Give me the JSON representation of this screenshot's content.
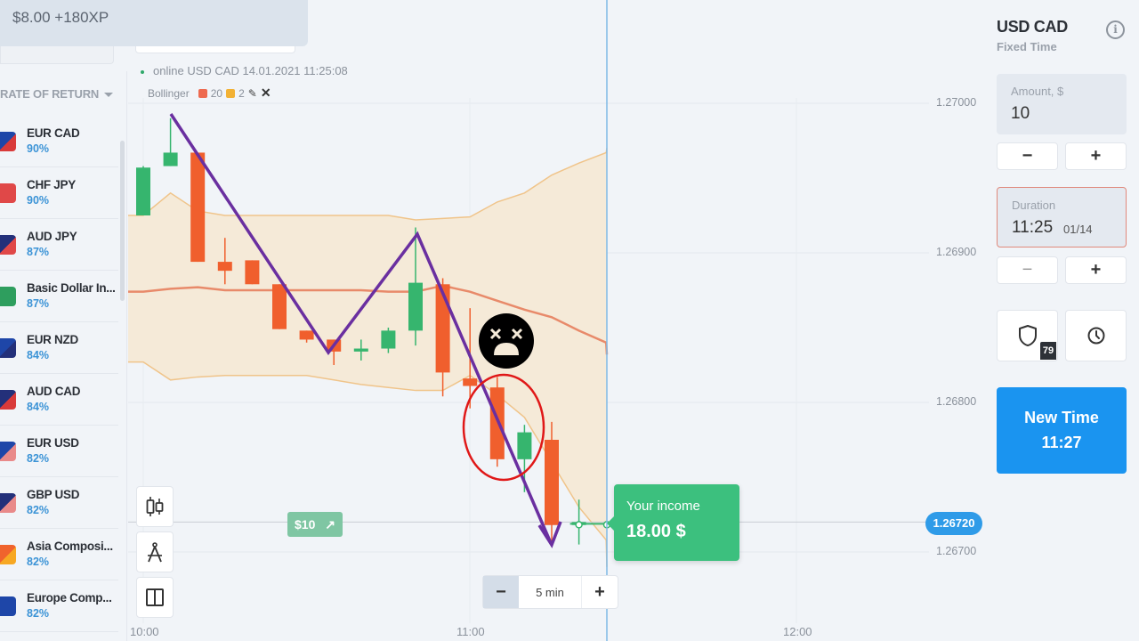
{
  "notification": {
    "text": "$8.00 +180XP"
  },
  "sidebar": {
    "sort_label": "RATE OF RETURN",
    "assets": [
      {
        "name": "EUR CAD",
        "rate": "90%",
        "icon": "eur-cad-flag",
        "color": "#1e46a8",
        "color2": "#d93a3a"
      },
      {
        "name": "CHF JPY",
        "rate": "90%",
        "icon": "chf-jpy-flag",
        "color": "#e04848",
        "color2": "#e04848"
      },
      {
        "name": "AUD JPY",
        "rate": "87%",
        "icon": "aud-jpy-flag",
        "color": "#23307a",
        "color2": "#e04848"
      },
      {
        "name": "Basic Dollar In...",
        "rate": "87%",
        "icon": "dollar-index-icon",
        "color": "#2e9e5e",
        "color2": "#2e9e5e"
      },
      {
        "name": "EUR NZD",
        "rate": "84%",
        "icon": "eur-nzd-flag",
        "color": "#1e46a8",
        "color2": "#23307a"
      },
      {
        "name": "AUD CAD",
        "rate": "84%",
        "icon": "aud-cad-flag",
        "color": "#23307a",
        "color2": "#d93a3a"
      },
      {
        "name": "EUR USD",
        "rate": "82%",
        "icon": "eur-usd-flag",
        "color": "#1e46a8",
        "color2": "#e98a8a"
      },
      {
        "name": "GBP USD",
        "rate": "82%",
        "icon": "gbp-usd-flag",
        "color": "#23307a",
        "color2": "#e98a8a"
      },
      {
        "name": "Asia Composi...",
        "rate": "82%",
        "icon": "asia-composite-icon",
        "color": "#f0632d",
        "color2": "#f7a823"
      },
      {
        "name": "Europe Comp...",
        "rate": "82%",
        "icon": "europe-composite-icon",
        "color": "#1e46a8",
        "color2": "#1e46a8"
      }
    ]
  },
  "chart_header": {
    "status": "online",
    "symbol": "USD CAD",
    "timestamp": "14.01.2021 11:25:08",
    "indicator": "Bollinger",
    "period": "20",
    "deviation": "2",
    "period_color": "#ee6a4f",
    "deviation_color": "#f2b134"
  },
  "chart_data": {
    "type": "candlestick",
    "title": "USD CAD",
    "interval": "5 min",
    "y_ticks": [
      "1.27000",
      "1.26900",
      "1.26800",
      "1.26700"
    ],
    "y_tick_values": [
      1.27,
      1.269,
      1.268,
      1.267
    ],
    "x_ticks": [
      "10:00",
      "11:00",
      "12:00"
    ],
    "current_price": "1.26720",
    "ylim": [
      1.26685,
      1.2707
    ],
    "candles": [
      {
        "t": "10:00",
        "o": 1.26925,
        "h": 1.26958,
        "l": 1.26925,
        "c": 1.26957
      },
      {
        "t": "10:05",
        "o": 1.26958,
        "h": 1.2699,
        "l": 1.26958,
        "c": 1.26967
      },
      {
        "t": "10:10",
        "o": 1.26967,
        "h": 1.26967,
        "l": 1.26894,
        "c": 1.26894
      },
      {
        "t": "10:15",
        "o": 1.26894,
        "h": 1.2691,
        "l": 1.26879,
        "c": 1.26888
      },
      {
        "t": "10:20",
        "o": 1.26895,
        "h": 1.26895,
        "l": 1.26879,
        "c": 1.26879
      },
      {
        "t": "10:25",
        "o": 1.26879,
        "h": 1.26879,
        "l": 1.26849,
        "c": 1.26849
      },
      {
        "t": "10:30",
        "o": 1.26848,
        "h": 1.26848,
        "l": 1.2684,
        "c": 1.26842
      },
      {
        "t": "10:35",
        "o": 1.26842,
        "h": 1.26842,
        "l": 1.26825,
        "c": 1.26834
      },
      {
        "t": "10:40",
        "o": 1.26834,
        "h": 1.26842,
        "l": 1.26828,
        "c": 1.26836
      },
      {
        "t": "10:45",
        "o": 1.26836,
        "h": 1.2685,
        "l": 1.26833,
        "c": 1.26848
      },
      {
        "t": "10:50",
        "o": 1.26848,
        "h": 1.26917,
        "l": 1.26838,
        "c": 1.2688
      },
      {
        "t": "10:55",
        "o": 1.26879,
        "h": 1.26883,
        "l": 1.26804,
        "c": 1.2682
      },
      {
        "t": "11:00",
        "o": 1.26816,
        "h": 1.26863,
        "l": 1.26796,
        "c": 1.26811
      },
      {
        "t": "11:05",
        "o": 1.2681,
        "h": 1.26817,
        "l": 1.26757,
        "c": 1.26762
      },
      {
        "t": "11:10",
        "o": 1.26762,
        "h": 1.26785,
        "l": 1.2674,
        "c": 1.2678
      },
      {
        "t": "11:15",
        "o": 1.26775,
        "h": 1.26787,
        "l": 1.26705,
        "c": 1.26718
      },
      {
        "t": "11:20",
        "o": 1.26718,
        "h": 1.26735,
        "l": 1.26705,
        "c": 1.2672
      }
    ],
    "bollinger_upper": [
      1.26925,
      1.2694,
      1.26928,
      1.26925,
      1.26925,
      1.26925,
      1.26925,
      1.26925,
      1.26925,
      1.26925,
      1.26922,
      1.26923,
      1.26924,
      1.26934,
      1.2694,
      1.26952,
      1.2696,
      1.26967,
      1.2697
    ],
    "bollinger_middle": [
      1.26874,
      1.26876,
      1.26877,
      1.26875,
      1.26875,
      1.26875,
      1.26875,
      1.26875,
      1.26875,
      1.26874,
      1.26874,
      1.26878,
      1.26874,
      1.26868,
      1.26862,
      1.26857,
      1.26848,
      1.2684,
      1.26832
    ],
    "bollinger_lower": [
      1.26827,
      1.26815,
      1.26817,
      1.26818,
      1.26818,
      1.26818,
      1.26818,
      1.26815,
      1.26812,
      1.2681,
      1.26808,
      1.26808,
      1.26818,
      1.26805,
      1.2679,
      1.2676,
      1.2673,
      1.26708,
      1.2669
    ],
    "annotations": {
      "zigzag_label": "trend drawing",
      "circled_candles": [
        "11:05",
        "11:10"
      ],
      "emoji": "dizzy-face"
    }
  },
  "chart_overlay": {
    "bet_tag": "$10",
    "income_label": "Your income",
    "income_value": "18.00 $",
    "zoom_label": "5 min",
    "zoom_minus": "−",
    "zoom_plus": "+"
  },
  "right_panel": {
    "asset": "USD CAD",
    "mode": "Fixed Time",
    "info_glyph": "i",
    "amount_label": "Amount, $",
    "amount_value": "10",
    "duration_label": "Duration",
    "duration_time": "11:25",
    "duration_date": "01/14",
    "minus": "−",
    "plus": "+",
    "insurance_badge": "79",
    "new_time_label": "New Time",
    "new_time_value": "11:27",
    "accent_color": "#1a94f0"
  }
}
